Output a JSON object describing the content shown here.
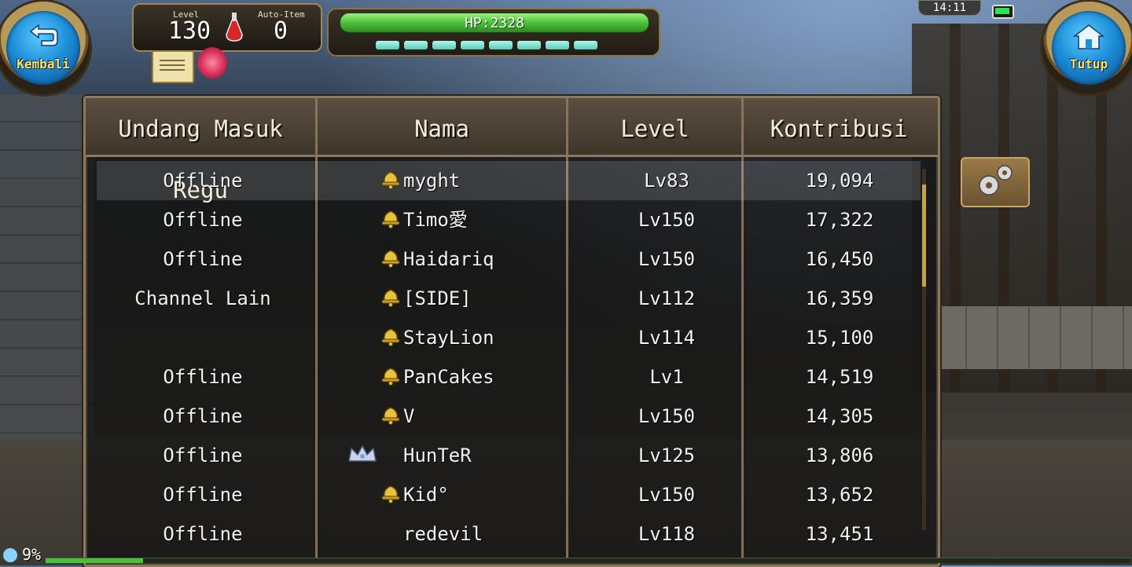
{
  "hud": {
    "level_label": "Level",
    "level_value": "130",
    "autoitem_label": "Auto-Item",
    "autoitem_value": "0",
    "hp_text": "HP:2328",
    "clock": "14:11",
    "xp_percent": "9%",
    "xp_fraction": 0.09,
    "mp_segments": 8
  },
  "buttons": {
    "back_label": "Kembali",
    "close_label": "Tutup"
  },
  "table": {
    "headers": [
      "Undang Masuk Regu",
      "Nama",
      "Level",
      "Kontribusi"
    ],
    "rows": [
      {
        "status": "Offline",
        "name": "myght",
        "level": "Lv83",
        "kontribusi": "19,094",
        "icon": "bell-icon",
        "selected": true
      },
      {
        "status": "Offline",
        "name": "Timo愛",
        "level": "Lv150",
        "kontribusi": "17,322",
        "icon": "bell-icon"
      },
      {
        "status": "Offline",
        "name": "Haidariq",
        "level": "Lv150",
        "kontribusi": "16,450",
        "icon": "bell-icon"
      },
      {
        "status": "Channel Lain",
        "name": "[SIDE]",
        "level": "Lv112",
        "kontribusi": "16,359",
        "icon": "bell-icon"
      },
      {
        "status": "",
        "name": "StayLion",
        "level": "Lv114",
        "kontribusi": "15,100",
        "icon": "bell-icon"
      },
      {
        "status": "Offline",
        "name": "PanCakes",
        "level": "Lv1",
        "kontribusi": "14,519",
        "icon": "bell-icon"
      },
      {
        "status": "Offline",
        "name": "V",
        "level": "Lv150",
        "kontribusi": "14,305",
        "icon": "bell-icon"
      },
      {
        "status": "Offline",
        "name": "HunTeR",
        "level": "Lv125",
        "kontribusi": "13,806",
        "icon": "crown-icon"
      },
      {
        "status": "Offline",
        "name": "Kid°",
        "level": "Lv150",
        "kontribusi": "13,652",
        "icon": "bell-icon"
      },
      {
        "status": "Offline",
        "name": "redevil",
        "level": "Lv118",
        "kontribusi": "13,451",
        "icon": ""
      }
    ]
  },
  "colors": {
    "hp": "#4ac13b",
    "accent_gold": "#c8a24a",
    "button_blue": "#1c8fd8"
  }
}
